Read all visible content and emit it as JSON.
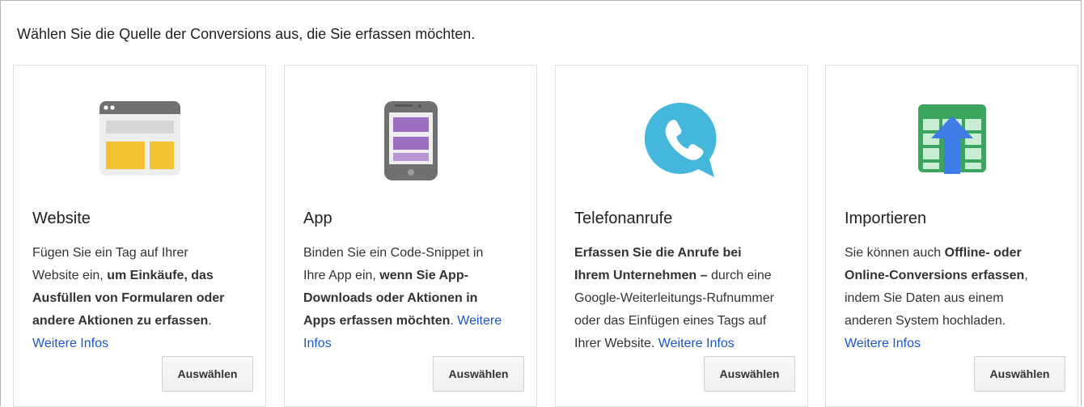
{
  "intro": "Wählen Sie die Quelle der Conversions aus, die Sie erfassen möchten.",
  "cards": [
    {
      "icon": "website-browser-icon",
      "title": "Website",
      "desc_parts": [
        {
          "t": "Fügen Sie ein Tag auf Ihrer Website ein, ",
          "b": false
        },
        {
          "t": "um Einkäufe, das Ausfüllen von Formularen oder andere Aktionen zu erfassen",
          "b": true
        },
        {
          "t": ". ",
          "b": false
        }
      ],
      "more": "Weitere Infos",
      "button": "Auswählen"
    },
    {
      "icon": "mobile-app-icon",
      "title": "App",
      "desc_parts": [
        {
          "t": "Binden Sie ein Code-Snippet in Ihre App ein, ",
          "b": false
        },
        {
          "t": "wenn Sie App-Downloads oder Aktionen in Apps erfassen möchten",
          "b": true
        },
        {
          "t": ". ",
          "b": false
        }
      ],
      "more": "Weitere Infos",
      "button": "Auswählen"
    },
    {
      "icon": "phone-call-icon",
      "title": "Telefonanrufe",
      "desc_parts": [
        {
          "t": "Erfassen Sie die Anrufe bei Ihrem Unternehmen – ",
          "b": true
        },
        {
          "t": "durch eine Google-Weiterleitungs-Rufnummer oder das Einfügen eines Tags auf Ihrer Website. ",
          "b": false
        }
      ],
      "more": "Weitere Infos",
      "button": "Auswählen"
    },
    {
      "icon": "import-spreadsheet-icon",
      "title": "Importieren",
      "desc_parts": [
        {
          "t": "Sie können auch ",
          "b": false
        },
        {
          "t": "Offline- oder Online-Conversions erfassen",
          "b": true
        },
        {
          "t": ", indem Sie Daten aus einem anderen System hochladen. ",
          "b": false
        }
      ],
      "more": "Weitere Infos",
      "button": "Auswählen"
    }
  ],
  "colors": {
    "link": "#1a55cc",
    "website_yellow": "#f2c232",
    "app_purple": "#9b6fbf",
    "phone_blue": "#45b7dc",
    "import_green": "#3ba55d",
    "import_arrow": "#3f7de6"
  }
}
